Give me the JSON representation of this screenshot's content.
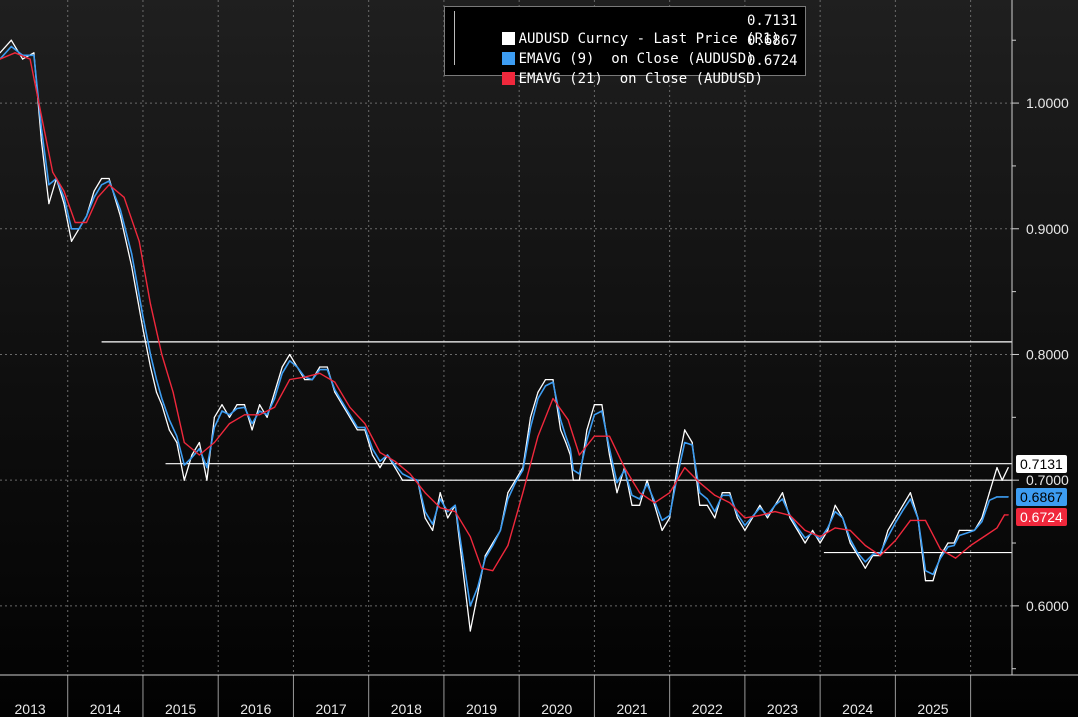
{
  "legend": {
    "rows": [
      {
        "label": "AUDUSD Curncy - Last Price (R1)",
        "value": "0.7131",
        "color": "#ffffff"
      },
      {
        "label": "EMAVG (9)  on Close (AUDUSD)",
        "value": "0.6867",
        "color": "#3d9df2"
      },
      {
        "label": "EMAVG (21)  on Close (AUDUSD)",
        "value": "0.6724",
        "color": "#f0283c"
      }
    ]
  },
  "price_tags": [
    {
      "label": "0.7131",
      "value": 0.7131,
      "bg": "#ffffff",
      "fg": "#000000"
    },
    {
      "label": "0.6867",
      "value": 0.6867,
      "bg": "#3d9df2",
      "fg": "#000000"
    },
    {
      "label": "0.6724",
      "value": 0.6724,
      "bg": "#f0283c",
      "fg": "#ffffff"
    }
  ],
  "chart_data": {
    "type": "line",
    "title": "",
    "xlabel": "",
    "ylabel": "",
    "x_range": [
      2012.6,
      2026.05
    ],
    "ylim": [
      0.545,
      1.082
    ],
    "y_axis_side": "right",
    "y_ticks": [
      {
        "value": 1.0,
        "label": "1.0000"
      },
      {
        "value": 0.9,
        "label": "0.9000"
      },
      {
        "value": 0.8,
        "label": "0.8000"
      },
      {
        "value": 0.7,
        "label": "0.7000"
      },
      {
        "value": 0.6,
        "label": "0.6000"
      }
    ],
    "x_ticks": [
      {
        "label": "2013",
        "value": 2013.0
      },
      {
        "label": "2014",
        "value": 2014.0
      },
      {
        "label": "2015",
        "value": 2015.0
      },
      {
        "label": "2016",
        "value": 2016.0
      },
      {
        "label": "2017",
        "value": 2017.0
      },
      {
        "label": "2018",
        "value": 2018.0
      },
      {
        "label": "2019",
        "value": 2019.0
      },
      {
        "label": "2020",
        "value": 2020.0
      },
      {
        "label": "2021",
        "value": 2021.0
      },
      {
        "label": "2022",
        "value": 2022.0
      },
      {
        "label": "2023",
        "value": 2023.0
      },
      {
        "label": "2024",
        "value": 2024.0
      },
      {
        "label": "2025",
        "value": 2025.0
      }
    ],
    "grid": true,
    "legend_position": "top-center",
    "series": [
      {
        "name": "AUDUSD Curncy - Last Price (R1)",
        "color": "#ffffff",
        "x": [
          2012.6,
          2012.75,
          2012.9,
          2013.05,
          2013.15,
          2013.25,
          2013.35,
          2013.45,
          2013.55,
          2013.65,
          2013.75,
          2013.85,
          2013.95,
          2014.05,
          2014.2,
          2014.35,
          2014.5,
          2014.6,
          2014.68,
          2014.75,
          2014.85,
          2014.95,
          2015.05,
          2015.15,
          2015.25,
          2015.35,
          2015.45,
          2015.55,
          2015.65,
          2015.75,
          2015.85,
          2015.95,
          2016.05,
          2016.15,
          2016.25,
          2016.35,
          2016.45,
          2016.55,
          2016.65,
          2016.75,
          2016.85,
          2016.95,
          2017.05,
          2017.15,
          2017.25,
          2017.35,
          2017.45,
          2017.55,
          2017.65,
          2017.75,
          2017.85,
          2017.95,
          2018.05,
          2018.15,
          2018.25,
          2018.35,
          2018.45,
          2018.55,
          2018.65,
          2018.75,
          2018.85,
          2018.95,
          2019.05,
          2019.15,
          2019.25,
          2019.35,
          2019.45,
          2019.55,
          2019.65,
          2019.75,
          2019.85,
          2019.95,
          2020.05,
          2020.12,
          2020.18,
          2020.22,
          2020.3,
          2020.4,
          2020.5,
          2020.6,
          2020.7,
          2020.8,
          2020.9,
          2021.0,
          2021.1,
          2021.2,
          2021.3,
          2021.4,
          2021.5,
          2021.6,
          2021.7,
          2021.8,
          2021.9,
          2022.0,
          2022.1,
          2022.2,
          2022.3,
          2022.4,
          2022.5,
          2022.6,
          2022.7,
          2022.8,
          2022.9,
          2023.0,
          2023.1,
          2023.2,
          2023.3,
          2023.4,
          2023.5,
          2023.6,
          2023.7,
          2023.8,
          2023.9,
          2024.0,
          2024.1,
          2024.2,
          2024.3,
          2024.4,
          2024.5,
          2024.6,
          2024.7,
          2024.8,
          2024.9,
          2025.0,
          2025.1,
          2025.2,
          2025.28,
          2025.35,
          2025.45,
          2025.55,
          2025.65,
          2025.75,
          2025.85,
          2025.92,
          2026.0
        ],
        "y": [
          1.04,
          1.05,
          1.035,
          1.04,
          0.97,
          0.92,
          0.94,
          0.92,
          0.89,
          0.9,
          0.91,
          0.93,
          0.94,
          0.94,
          0.91,
          0.87,
          0.82,
          0.79,
          0.77,
          0.76,
          0.74,
          0.73,
          0.7,
          0.72,
          0.73,
          0.7,
          0.75,
          0.76,
          0.75,
          0.76,
          0.76,
          0.74,
          0.76,
          0.75,
          0.77,
          0.79,
          0.8,
          0.79,
          0.78,
          0.78,
          0.79,
          0.79,
          0.77,
          0.76,
          0.75,
          0.74,
          0.74,
          0.72,
          0.71,
          0.72,
          0.71,
          0.7,
          0.7,
          0.7,
          0.67,
          0.66,
          0.69,
          0.67,
          0.68,
          0.63,
          0.58,
          0.61,
          0.64,
          0.65,
          0.66,
          0.69,
          0.7,
          0.71,
          0.75,
          0.77,
          0.78,
          0.78,
          0.74,
          0.73,
          0.72,
          0.7,
          0.7,
          0.74,
          0.76,
          0.76,
          0.72,
          0.69,
          0.71,
          0.68,
          0.68,
          0.7,
          0.68,
          0.66,
          0.67,
          0.71,
          0.74,
          0.73,
          0.68,
          0.68,
          0.67,
          0.69,
          0.69,
          0.67,
          0.66,
          0.67,
          0.68,
          0.67,
          0.68,
          0.69,
          0.67,
          0.66,
          0.65,
          0.66,
          0.65,
          0.66,
          0.68,
          0.67,
          0.65,
          0.64,
          0.63,
          0.64,
          0.64,
          0.66,
          0.67,
          0.68,
          0.69,
          0.67,
          0.62,
          0.62,
          0.64,
          0.65,
          0.65,
          0.66,
          0.66,
          0.66,
          0.67,
          0.69,
          0.71,
          0.7,
          0.71
        ]
      },
      {
        "name": "EMAVG (9)  on Close (AUDUSD)",
        "color": "#3d9df2",
        "x": [
          2012.6,
          2012.75,
          2012.9,
          2013.05,
          2013.15,
          2013.25,
          2013.35,
          2013.45,
          2013.55,
          2013.65,
          2013.75,
          2013.85,
          2013.95,
          2014.05,
          2014.2,
          2014.35,
          2014.5,
          2014.6,
          2014.68,
          2014.75,
          2014.85,
          2014.95,
          2015.05,
          2015.15,
          2015.25,
          2015.35,
          2015.45,
          2015.55,
          2015.65,
          2015.75,
          2015.85,
          2015.95,
          2016.05,
          2016.15,
          2016.25,
          2016.35,
          2016.45,
          2016.55,
          2016.65,
          2016.75,
          2016.85,
          2016.95,
          2017.05,
          2017.15,
          2017.25,
          2017.35,
          2017.45,
          2017.55,
          2017.65,
          2017.75,
          2017.85,
          2017.95,
          2018.05,
          2018.15,
          2018.25,
          2018.35,
          2018.45,
          2018.55,
          2018.65,
          2018.75,
          2018.85,
          2018.95,
          2019.05,
          2019.15,
          2019.25,
          2019.35,
          2019.45,
          2019.55,
          2019.65,
          2019.75,
          2019.85,
          2019.95,
          2020.05,
          2020.12,
          2020.18,
          2020.22,
          2020.3,
          2020.4,
          2020.5,
          2020.6,
          2020.7,
          2020.8,
          2020.9,
          2021.0,
          2021.1,
          2021.2,
          2021.3,
          2021.4,
          2021.5,
          2021.6,
          2021.7,
          2021.8,
          2021.9,
          2022.0,
          2022.1,
          2022.2,
          2022.3,
          2022.4,
          2022.5,
          2022.6,
          2022.7,
          2022.8,
          2022.9,
          2023.0,
          2023.1,
          2023.2,
          2023.3,
          2023.4,
          2023.5,
          2023.6,
          2023.7,
          2023.8,
          2023.9,
          2024.0,
          2024.1,
          2024.2,
          2024.3,
          2024.4,
          2024.5,
          2024.6,
          2024.7,
          2024.8,
          2024.9,
          2025.0,
          2025.1,
          2025.2,
          2025.28,
          2025.35,
          2025.45,
          2025.55,
          2025.65,
          2025.75,
          2025.85,
          2025.92,
          2026.0
        ],
        "y": [
          1.035,
          1.045,
          1.038,
          1.038,
          0.98,
          0.935,
          0.94,
          0.925,
          0.9,
          0.9,
          0.91,
          0.925,
          0.935,
          0.938,
          0.915,
          0.88,
          0.83,
          0.8,
          0.78,
          0.765,
          0.748,
          0.735,
          0.712,
          0.718,
          0.725,
          0.71,
          0.742,
          0.755,
          0.752,
          0.757,
          0.758,
          0.745,
          0.755,
          0.752,
          0.765,
          0.785,
          0.795,
          0.79,
          0.782,
          0.78,
          0.788,
          0.788,
          0.772,
          0.762,
          0.752,
          0.742,
          0.742,
          0.725,
          0.715,
          0.72,
          0.712,
          0.705,
          0.702,
          0.7,
          0.675,
          0.665,
          0.685,
          0.675,
          0.68,
          0.64,
          0.6,
          0.615,
          0.638,
          0.648,
          0.66,
          0.685,
          0.698,
          0.708,
          0.742,
          0.765,
          0.775,
          0.778,
          0.748,
          0.735,
          0.725,
          0.708,
          0.705,
          0.732,
          0.752,
          0.755,
          0.725,
          0.698,
          0.708,
          0.688,
          0.685,
          0.697,
          0.683,
          0.668,
          0.672,
          0.703,
          0.73,
          0.728,
          0.69,
          0.685,
          0.675,
          0.688,
          0.688,
          0.673,
          0.664,
          0.671,
          0.678,
          0.672,
          0.68,
          0.685,
          0.672,
          0.662,
          0.654,
          0.658,
          0.653,
          0.662,
          0.675,
          0.67,
          0.653,
          0.642,
          0.635,
          0.641,
          0.642,
          0.655,
          0.666,
          0.676,
          0.685,
          0.67,
          0.628,
          0.625,
          0.638,
          0.647,
          0.648,
          0.656,
          0.658,
          0.66,
          0.667,
          0.684,
          0.6867,
          0.6867,
          0.6867
        ]
      },
      {
        "name": "EMAVG (21)  on Close (AUDUSD)",
        "color": "#f0283c",
        "x": [
          2012.6,
          2012.8,
          2013.0,
          2013.15,
          2013.3,
          2013.45,
          2013.6,
          2013.75,
          2013.9,
          2014.05,
          2014.25,
          2014.45,
          2014.6,
          2014.75,
          2014.9,
          2015.05,
          2015.25,
          2015.45,
          2015.65,
          2015.85,
          2016.05,
          2016.25,
          2016.45,
          2016.65,
          2016.85,
          2017.05,
          2017.25,
          2017.45,
          2017.65,
          2017.85,
          2018.05,
          2018.25,
          2018.45,
          2018.65,
          2018.85,
          2019.0,
          2019.15,
          2019.35,
          2019.55,
          2019.75,
          2019.95,
          2020.15,
          2020.3,
          2020.5,
          2020.7,
          2020.9,
          2021.1,
          2021.3,
          2021.5,
          2021.7,
          2021.9,
          2022.1,
          2022.3,
          2022.5,
          2022.7,
          2022.9,
          2023.1,
          2023.3,
          2023.5,
          2023.7,
          2023.9,
          2024.1,
          2024.3,
          2024.5,
          2024.7,
          2024.9,
          2025.1,
          2025.3,
          2025.5,
          2025.7,
          2025.85,
          2025.95,
          2026.0
        ],
        "y": [
          1.035,
          1.04,
          1.035,
          0.99,
          0.945,
          0.93,
          0.905,
          0.905,
          0.925,
          0.935,
          0.925,
          0.89,
          0.84,
          0.8,
          0.77,
          0.73,
          0.72,
          0.73,
          0.745,
          0.752,
          0.752,
          0.758,
          0.78,
          0.782,
          0.785,
          0.778,
          0.758,
          0.745,
          0.722,
          0.715,
          0.705,
          0.69,
          0.678,
          0.675,
          0.655,
          0.63,
          0.628,
          0.648,
          0.69,
          0.735,
          0.765,
          0.748,
          0.72,
          0.735,
          0.735,
          0.71,
          0.69,
          0.682,
          0.69,
          0.71,
          0.698,
          0.688,
          0.682,
          0.67,
          0.672,
          0.675,
          0.672,
          0.66,
          0.655,
          0.662,
          0.66,
          0.648,
          0.64,
          0.652,
          0.668,
          0.668,
          0.645,
          0.638,
          0.648,
          0.656,
          0.662,
          0.6724,
          0.6724
        ]
      }
    ],
    "reference_lines": [
      {
        "x0": 2013.95,
        "x1": 2026.05,
        "y": 0.81,
        "color": "#ffffff"
      },
      {
        "x0": 2014.8,
        "x1": 2026.05,
        "y": 0.7131,
        "color": "#ffffff"
      },
      {
        "x0": 2018.0,
        "x1": 2026.05,
        "y": 0.7,
        "color": "#ffffff"
      },
      {
        "x0": 2023.55,
        "x1": 2026.05,
        "y": 0.6424,
        "color": "#ffffff"
      }
    ]
  }
}
